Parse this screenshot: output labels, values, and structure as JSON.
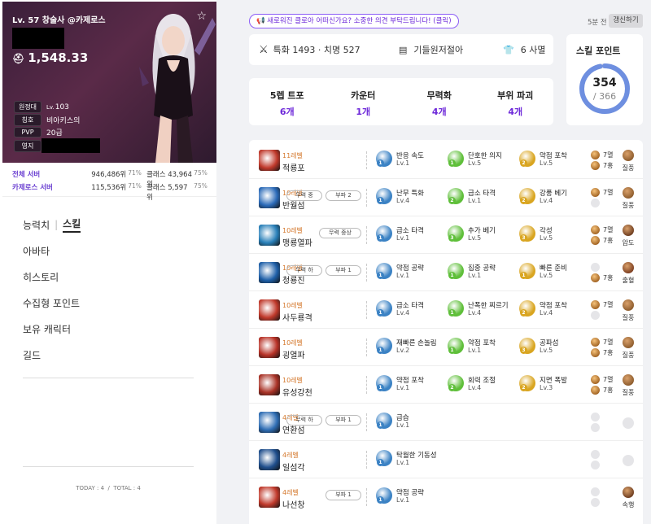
{
  "profile": {
    "title": "Lv. 57 창술사 @카제로스",
    "item_level": "1,548.33",
    "attrs": [
      {
        "tag": "원정대",
        "prefix": "Lv.",
        "value": "103"
      },
      {
        "tag": "칭호",
        "prefix": "",
        "value": "비아키스의"
      },
      {
        "tag": "PVP",
        "prefix": "",
        "value": "20급"
      },
      {
        "tag": "영지",
        "prefix": "",
        "value": ""
      }
    ]
  },
  "ranks": [
    {
      "label": "전체 서버",
      "value": "946,486위",
      "pct": "71%",
      "cls_label": "클래스",
      "cls_value": "43,964위",
      "cls_pct": "75%"
    },
    {
      "label": "카제로스 서버",
      "value": "115,536위",
      "pct": "71%",
      "cls_label": "클래스",
      "cls_value": "5,597위",
      "cls_pct": "75%"
    }
  ],
  "nav": {
    "tab1": "능력치",
    "tab2": "스킬",
    "items": [
      "아바타",
      "히스토리",
      "수집형 포인트",
      "보유 캐릭터",
      "길드"
    ],
    "today": "TODAY : 4",
    "total": "TOTAL : 4"
  },
  "header": {
    "feedback": "새로워진 클로아 어떠신가요? 소중한 의견 부탁드립니다! (클릭)",
    "ago": "5분 전",
    "refresh": "갱신하기"
  },
  "stats": {
    "combat": "특화 1493 · 치명 527",
    "engraving": "기들원저절아",
    "set": "6 사멸"
  },
  "tripod_summary": [
    {
      "title": "5렙 트포",
      "count": "6개"
    },
    {
      "title": "카운터",
      "count": "1개"
    },
    {
      "title": "무력화",
      "count": "4개"
    },
    {
      "title": "부위 파괴",
      "count": "4개"
    }
  ],
  "skill_points": {
    "title": "스킬 포인트",
    "used": "354",
    "total": "/ 366",
    "ratio": 0.967
  },
  "skills": [
    {
      "level": "11레벨",
      "name": "적룡포",
      "badges": [],
      "icon_color": "#c0392b",
      "tripods": [
        {
          "name": "반응 속도",
          "lv": "Lv.1",
          "n": "1",
          "color": "#3b82c4"
        },
        {
          "name": "단호한 의지",
          "lv": "Lv.5",
          "n": "1",
          "color": "#5fbf3a"
        },
        {
          "name": "약점 포착",
          "lv": "Lv.5",
          "n": "2",
          "color": "#d9a520"
        }
      ],
      "gems": [
        "7멸",
        "7홍"
      ],
      "rune": "질풍",
      "rune_color": "#8b5a2b"
    },
    {
      "level": "10레벨",
      "name": "반월섬",
      "badges": [
        "무력 중",
        "부파 2"
      ],
      "icon_color": "#2a6ab8",
      "tripods": [
        {
          "name": "난무 특화",
          "lv": "Lv.4",
          "n": "1",
          "color": "#3b82c4"
        },
        {
          "name": "급소 타격",
          "lv": "Lv.1",
          "n": "2",
          "color": "#5fbf3a"
        },
        {
          "name": "강풍 베기",
          "lv": "Lv.4",
          "n": "2",
          "color": "#d9a520"
        }
      ],
      "gems": [
        "7멸",
        ""
      ],
      "rune": "질풍",
      "rune_color": "#8b5a2b"
    },
    {
      "level": "10레벨",
      "name": "맹룡열파",
      "badges": [
        "무력 중상"
      ],
      "icon_color": "#2980b9",
      "tripods": [
        {
          "name": "급소 타격",
          "lv": "Lv.1",
          "n": "1",
          "color": "#3b82c4"
        },
        {
          "name": "추가 베기",
          "lv": "Lv.5",
          "n": "3",
          "color": "#5fbf3a"
        },
        {
          "name": "각성",
          "lv": "Lv.5",
          "n": "3",
          "color": "#d9a520"
        }
      ],
      "gems": [
        "7멸",
        "7홍"
      ],
      "rune": "압도",
      "rune_color": "#6b3a1e"
    },
    {
      "level": "10레벨",
      "name": "청룡진",
      "badges": [
        "무력 하",
        "부파 1"
      ],
      "icon_color": "#1e5fa8",
      "tripods": [
        {
          "name": "약점 공략",
          "lv": "Lv.1",
          "n": "1",
          "color": "#3b82c4"
        },
        {
          "name": "집중 공략",
          "lv": "Lv.1",
          "n": "1",
          "color": "#5fbf3a"
        },
        {
          "name": "빠른 준비",
          "lv": "Lv.5",
          "n": "1",
          "color": "#d9a520"
        }
      ],
      "gems": [
        "",
        "7홍"
      ],
      "rune": "출혈",
      "rune_color": "#7a3b1e"
    },
    {
      "level": "10레벨",
      "name": "사두룡격",
      "badges": [],
      "icon_color": "#c0392b",
      "tripods": [
        {
          "name": "급소 타격",
          "lv": "Lv.4",
          "n": "1",
          "color": "#3b82c4"
        },
        {
          "name": "난폭한 찌르기",
          "lv": "Lv.4",
          "n": "1",
          "color": "#5fbf3a"
        },
        {
          "name": "약점 포착",
          "lv": "Lv.4",
          "n": "2",
          "color": "#d9a520"
        }
      ],
      "gems": [
        "7멸",
        ""
      ],
      "rune": "질풍",
      "rune_color": "#8b5a2b"
    },
    {
      "level": "10레벨",
      "name": "굉열파",
      "badges": [],
      "icon_color": "#b83227",
      "tripods": [
        {
          "name": "재빠른 손놀림",
          "lv": "Lv.2",
          "n": "1",
          "color": "#3b82c4"
        },
        {
          "name": "약점 포착",
          "lv": "Lv.1",
          "n": "1",
          "color": "#5fbf3a"
        },
        {
          "name": "공파섬",
          "lv": "Lv.5",
          "n": "3",
          "color": "#d9a520"
        }
      ],
      "gems": [
        "7멸",
        "7홍"
      ],
      "rune": "질풍",
      "rune_color": "#8b5a2b"
    },
    {
      "level": "10레벨",
      "name": "유성강천",
      "badges": [],
      "icon_color": "#a93226",
      "tripods": [
        {
          "name": "약점 포착",
          "lv": "Lv.1",
          "n": "1",
          "color": "#3b82c4"
        },
        {
          "name": "회력 조절",
          "lv": "Lv.4",
          "n": "2",
          "color": "#5fbf3a"
        },
        {
          "name": "지면 폭발",
          "lv": "Lv.3",
          "n": "2",
          "color": "#d9a520"
        }
      ],
      "gems": [
        "7멸",
        "7홍"
      ],
      "rune": "질풍",
      "rune_color": "#8b5a2b"
    },
    {
      "level": "4레벨",
      "name": "연환섬",
      "badges": [
        "무력 하",
        "부파 1"
      ],
      "icon_color": "#2e6db4",
      "tripods": [
        {
          "name": "급습",
          "lv": "Lv.1",
          "n": "1",
          "color": "#3b82c4"
        }
      ],
      "gems": [
        "",
        ""
      ],
      "rune": "",
      "rune_color": ""
    },
    {
      "level": "4레벨",
      "name": "일섬각",
      "badges": [],
      "icon_color": "#1f4e8c",
      "tripods": [
        {
          "name": "탁월한 기동성",
          "lv": "Lv.1",
          "n": "1",
          "color": "#3b82c4"
        }
      ],
      "gems": [
        "",
        ""
      ],
      "rune": "",
      "rune_color": ""
    },
    {
      "level": "4레벨",
      "name": "나선창",
      "badges": [
        "부파 1"
      ],
      "icon_color": "#c0392b",
      "tripods": [
        {
          "name": "약점 공략",
          "lv": "Lv.1",
          "n": "1",
          "color": "#3b82c4"
        }
      ],
      "gems": [
        "",
        ""
      ],
      "rune": "속행",
      "rune_color": "#6b3a1e"
    }
  ]
}
